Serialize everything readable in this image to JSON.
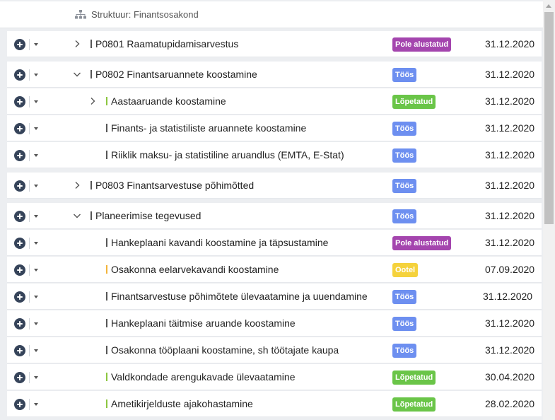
{
  "header": {
    "label": "Struktuur: Finantsosakond",
    "icon": "sitemap-icon"
  },
  "colors": {
    "pole_alustatud": "#a445ae",
    "toos": "#6d8ff0",
    "lopetatud": "#6ac548",
    "ootel": "#f5d23c",
    "bar_default": "#555555",
    "bar_orange": "#f3b43a",
    "bar_green": "#8cc63f"
  },
  "rows": [
    {
      "name": "P0801 Raamatupidamisarvestus",
      "status": "Pole alustatud",
      "date": "31.12.2020",
      "level": 0,
      "expander": "collapsed"
    },
    {
      "name": "P0802 Finantsaruannete koostamine",
      "status": "Töös",
      "date": "31.12.2020",
      "level": 0,
      "expander": "expanded"
    },
    {
      "name": "Aastaaruande koostamine",
      "status": "Lõpetatud",
      "date": "31.12.2020",
      "level": 1,
      "expander": "collapsed"
    },
    {
      "name": "Finants- ja statistiliste aruannete koostamine",
      "status": "Töös",
      "date": "31.12.2020",
      "level": 1,
      "expander": "none"
    },
    {
      "name": "Riiklik maksu- ja statistiline aruandlus (EMTA, E-Stat)",
      "status": "Töös",
      "date": "31.12.2020",
      "level": 1,
      "expander": "none"
    },
    {
      "name": "P0803 Finantsarvestuse põhimõtted",
      "status": "Töös",
      "date": "31.12.2020",
      "level": 0,
      "expander": "collapsed"
    },
    {
      "name": "Planeerimise tegevused",
      "status": "Töös",
      "date": "31.12.2020",
      "level": 0,
      "expander": "expanded"
    },
    {
      "name": "Hankeplaani kavandi koostamine ja täpsustamine",
      "status": "Pole alustatud",
      "date": "31.12.2020",
      "level": 1,
      "expander": "none"
    },
    {
      "name": "Osakonna eelarvekavandi koostamine",
      "status": "Ootel",
      "date": "07.09.2020",
      "level": 1,
      "expander": "none"
    },
    {
      "name": "Finantsarvestuse põhimõtete ülevaatamine ja uuendamine",
      "status": "Töös",
      "date": "31.12.2020",
      "level": 1,
      "expander": "none"
    },
    {
      "name": "Hankeplaani täitmise aruande koostamine",
      "status": "Töös",
      "date": "31.12.2020",
      "level": 1,
      "expander": "none"
    },
    {
      "name": "Osakonna tööplaani koostamine, sh töötajate kaupa",
      "status": "Töös",
      "date": "31.12.2020",
      "level": 1,
      "expander": "none"
    },
    {
      "name": "Valdkondade arengukavade ülevaatamine",
      "status": "Lõpetatud",
      "date": "30.04.2020",
      "level": 1,
      "expander": "none"
    },
    {
      "name": "Ametikirjelduste ajakohastamine",
      "status": "Lõpetatud",
      "date": "28.02.2020",
      "level": 1,
      "expander": "none"
    }
  ]
}
